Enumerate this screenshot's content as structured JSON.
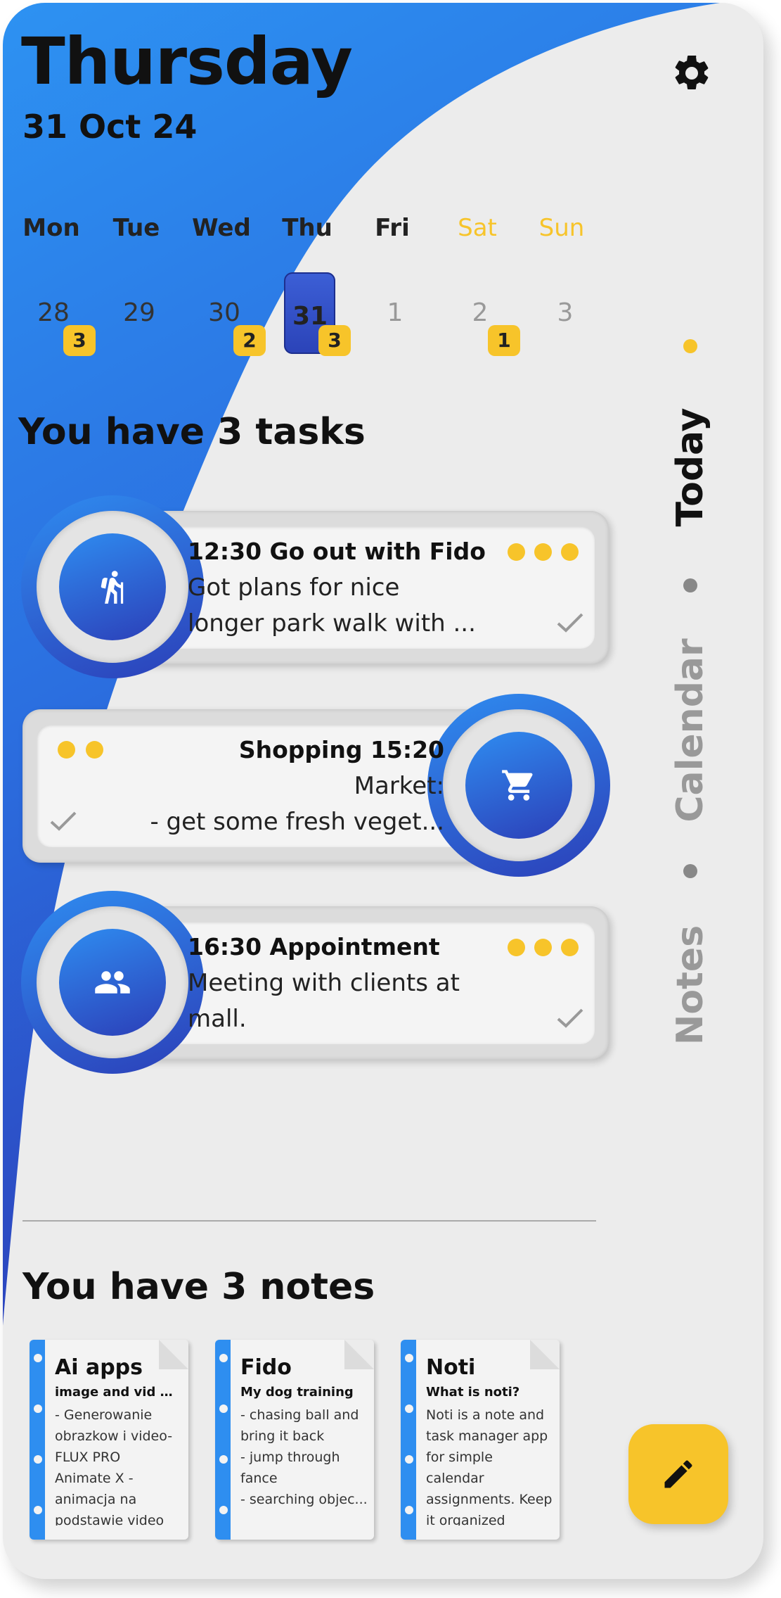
{
  "header": {
    "day": "Thursday",
    "date": "31 Oct 24"
  },
  "week": [
    {
      "name": "Mon",
      "num": "28",
      "badge": "3"
    },
    {
      "name": "Tue",
      "num": "29",
      "badge": ""
    },
    {
      "name": "Wed",
      "num": "30",
      "badge": "2"
    },
    {
      "name": "Thu",
      "num": "31",
      "badge": "3"
    },
    {
      "name": "Fri",
      "num": "1",
      "badge": ""
    },
    {
      "name": "Sat",
      "num": "2",
      "badge": "1"
    },
    {
      "name": "Sun",
      "num": "3",
      "badge": ""
    }
  ],
  "tasks_heading": "You have 3 tasks",
  "tasks": [
    {
      "time_title": "12:30  Go out with Fido",
      "line1": "Got plans for nice",
      "line2": "longer park walk with ...",
      "icon": "hiking-icon"
    },
    {
      "time_title": "Shopping 15:20",
      "line1": "Market:",
      "line2": "- get some fresh veget...",
      "icon": "cart-icon"
    },
    {
      "time_title": "16:30  Appointment",
      "line1": "Meeting with clients at",
      "line2": "mall.",
      "icon": "people-icon"
    }
  ],
  "nav": {
    "today": "Today",
    "calendar": "Calendar",
    "notes": "Notes"
  },
  "notes_heading": "You have 3 notes",
  "notes": [
    {
      "title": "Ai apps",
      "subtitle": "image and vid gen...",
      "body": "- Generowanie\nobrazkow i video-\nFLUX PRO\nAnimate X -\nanimacja na\npodstawie video"
    },
    {
      "title": "Fido",
      "subtitle": "My dog training",
      "body": "- chasing ball and\nbring it back\n- jump through\nfance\n- searching objec..."
    },
    {
      "title": "Noti",
      "subtitle": "What is noti?",
      "body": "Noti is a note and\ntask manager app\nfor simple\ncalendar\nassignments. Keep\nit organized"
    }
  ],
  "colors": {
    "accent_blue": "#2e8ef0",
    "accent_dark_blue": "#2c3fb8",
    "accent_yellow": "#f7c42a",
    "background": "#ececec"
  }
}
